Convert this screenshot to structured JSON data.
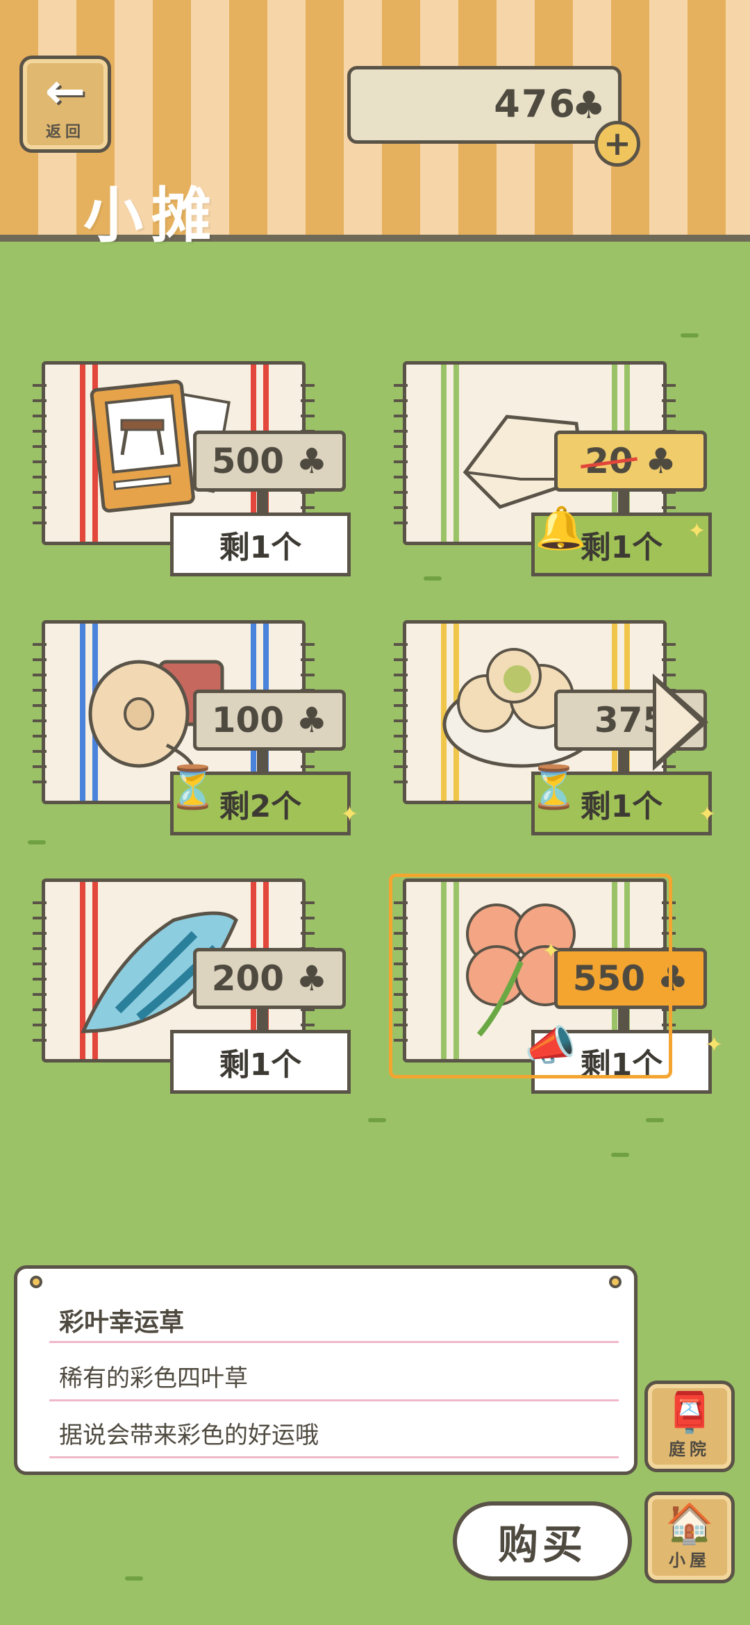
{
  "header": {
    "back_label": "返回",
    "back_icon": "arrow-left",
    "title": "小摊",
    "clover_count": "476",
    "clover_icon": "♣",
    "plus_icon": "+"
  },
  "items": [
    {
      "price": "500",
      "stock": "剩1个",
      "name": "table-catalog",
      "stripe_color": "#e3463a"
    },
    {
      "price": "20",
      "stock": "剩1个",
      "name": "bag",
      "stripe_color": "#9ac267"
    },
    {
      "price": "100",
      "stock": "剩2个",
      "name": "tape",
      "stripe_color": "#4a83dc"
    },
    {
      "price": "375",
      "stock": "剩1个",
      "name": "dumplings",
      "stripe_color": "#f0c64a"
    },
    {
      "price": "200",
      "stock": "剩1个",
      "name": "shell",
      "stripe_color": "#e3463a"
    },
    {
      "price": "550",
      "stock": "剩1个",
      "name": "clover",
      "stripe_color": "#9ac267"
    }
  ],
  "currency_symbol": "♣",
  "description": {
    "name": "彩叶幸运草",
    "line1": "稀有的彩色四叶草",
    "line2": "据说会带来彩色的好运哦"
  },
  "buttons": {
    "buy": "购买",
    "yard": "庭院",
    "house": "小屋"
  },
  "colors": {
    "grass": "#9cc268",
    "header_stripe_a": "#e6b15e",
    "header_stripe_b": "#f6d5a9",
    "selected": "#f4a530"
  }
}
